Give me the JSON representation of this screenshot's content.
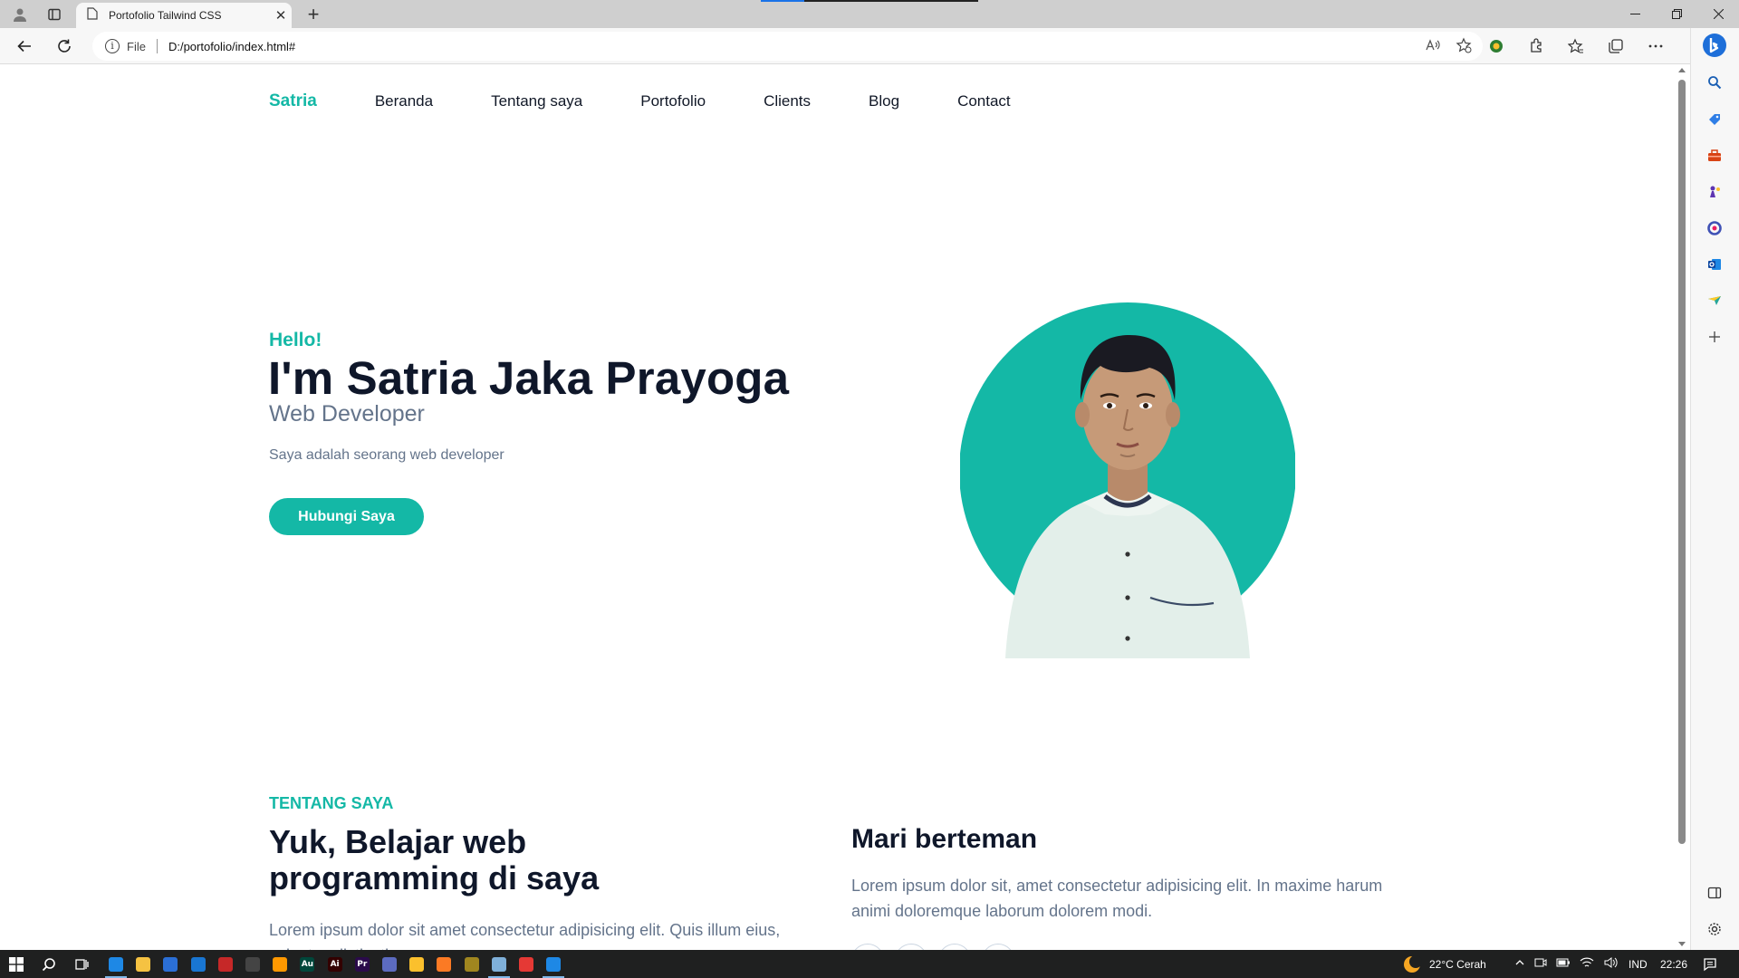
{
  "browser": {
    "tab_title": "Portofolio Tailwind CSS",
    "new_tab": "+",
    "address_scheme": "File",
    "address_url": "D:/portofolio/index.html#"
  },
  "site": {
    "brand": "Satria",
    "nav": [
      "Beranda",
      "Tentang saya",
      "Portofolio",
      "Clients",
      "Blog",
      "Contact"
    ],
    "hero": {
      "greeting": "Hello!",
      "name": "I'm Satria Jaka Prayoga",
      "role": "Web Developer",
      "description": "Saya adalah seorang web developer",
      "cta": "Hubungi Saya"
    },
    "about": {
      "label": "TENTANG SAYA",
      "title": "Yuk, Belajar web programming di saya",
      "text": "Lorem ipsum dolor sit amet consectetur adipisicing elit. Quis illum eius, voluptas distinctio...",
      "friend_title": "Mari berteman",
      "friend_text": "Lorem ipsum dolor sit, amet consectetur adipisicing elit. In maxime harum animi doloremque laborum dolorem modi."
    }
  },
  "taskbar": {
    "weather": "22°C Cerah",
    "language": "IND",
    "time": "22:26",
    "apps": [
      {
        "name": "edge",
        "label": "",
        "color": "#1e88e5"
      },
      {
        "name": "file-explorer",
        "label": "",
        "color": "#f5c242"
      },
      {
        "name": "store",
        "label": "",
        "color": "#2b6fd6"
      },
      {
        "name": "mail",
        "label": "",
        "color": "#1976d2"
      },
      {
        "name": "vector-app",
        "label": "",
        "color": "#c62828"
      },
      {
        "name": "unity",
        "label": "",
        "color": "#444444"
      },
      {
        "name": "sublime-text",
        "label": "",
        "color": "#ff9800"
      },
      {
        "name": "audition",
        "label": "Au",
        "color": "#00473b"
      },
      {
        "name": "illustrator",
        "label": "Ai",
        "color": "#330000"
      },
      {
        "name": "premiere",
        "label": "Pr",
        "color": "#2a0a4a"
      },
      {
        "name": "media-app",
        "label": "",
        "color": "#5c6bc0"
      },
      {
        "name": "sticky-notes",
        "label": "",
        "color": "#fbc02d"
      },
      {
        "name": "xampp",
        "label": "",
        "color": "#fb7a24"
      },
      {
        "name": "git-app",
        "label": "",
        "color": "#a0861f"
      },
      {
        "name": "notepad",
        "label": "",
        "color": "#7fb0d9"
      },
      {
        "name": "chrome",
        "label": "",
        "color": "#e53935"
      },
      {
        "name": "vscode",
        "label": "",
        "color": "#1e88e5"
      }
    ]
  },
  "colors": {
    "accent": "#14b8a6",
    "heading": "#0f172a",
    "muted": "#64748b"
  }
}
